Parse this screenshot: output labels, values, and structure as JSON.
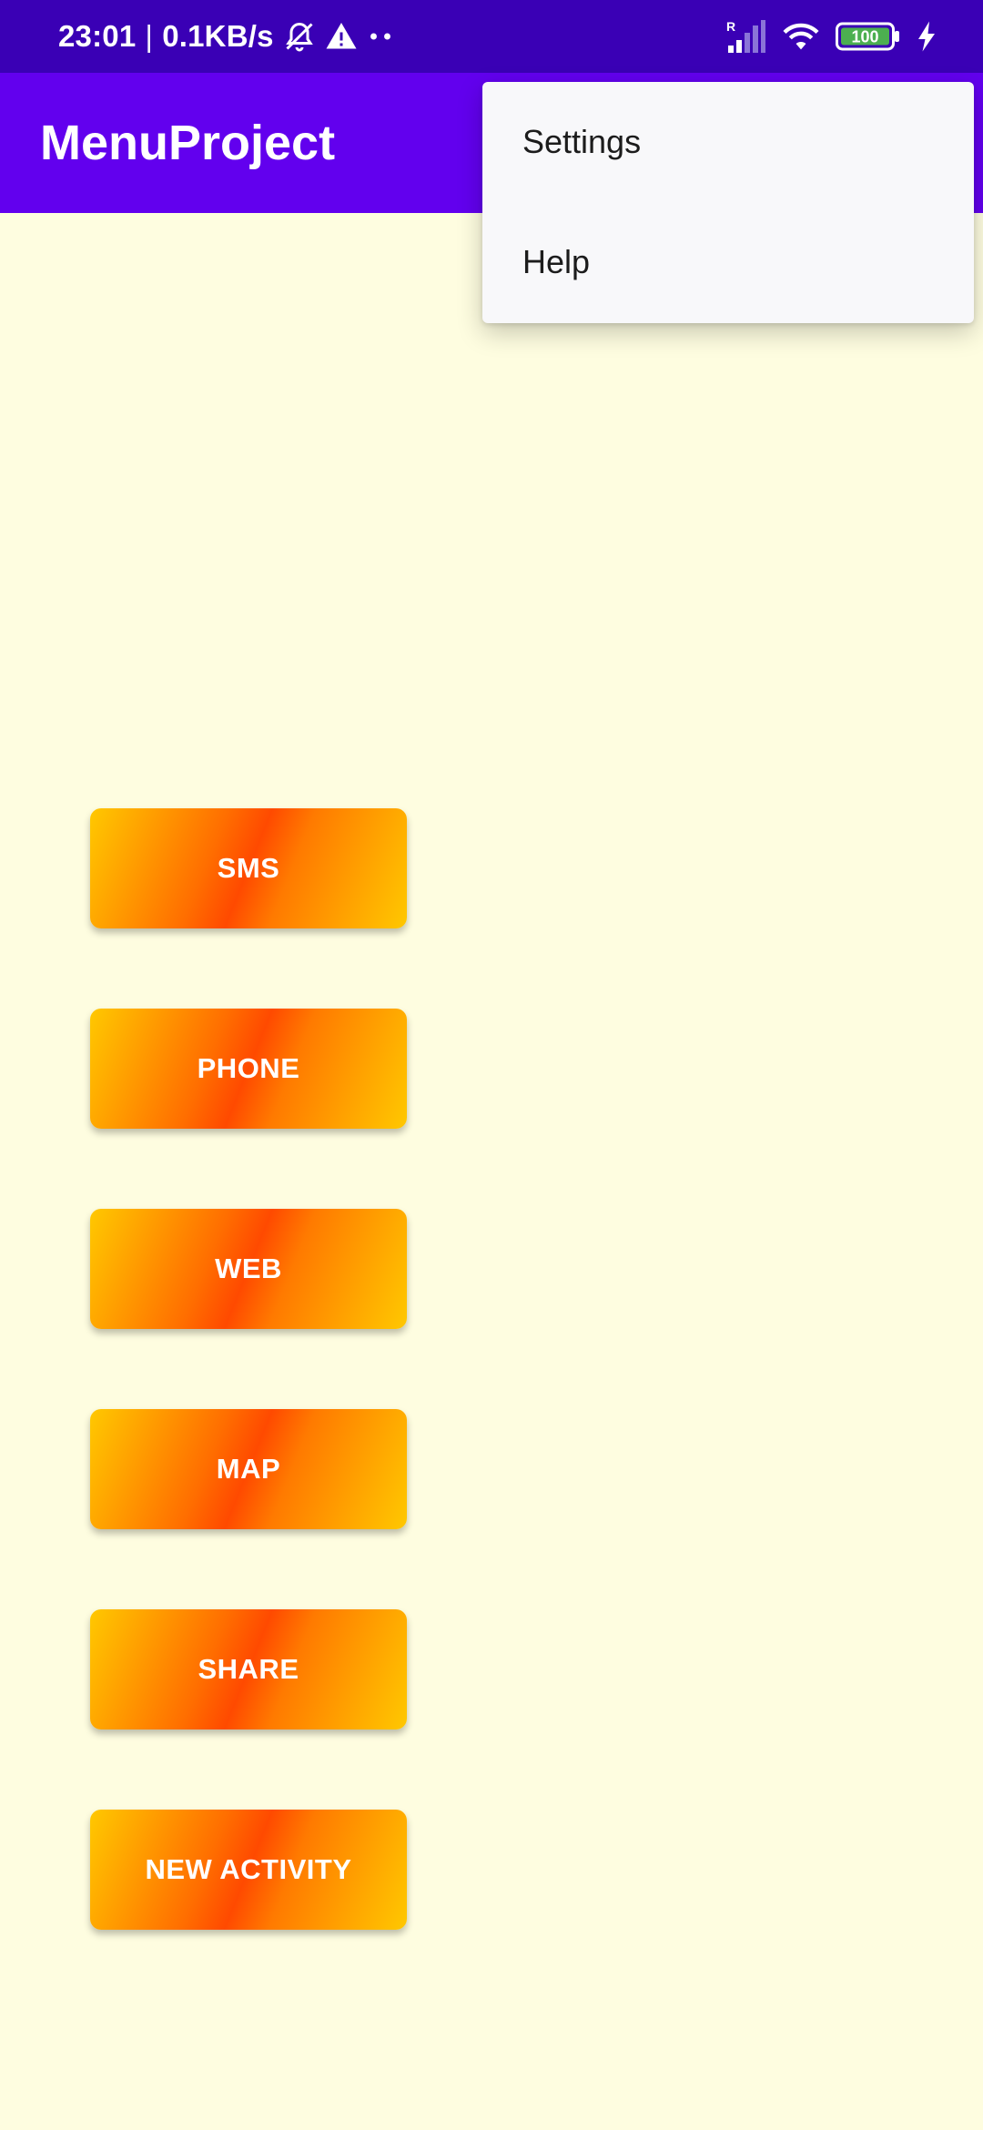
{
  "status_bar": {
    "time": "23:01",
    "separator": "|",
    "speed": "0.1KB/s",
    "battery_level": "100",
    "icons": [
      "bell-off-icon",
      "warning-icon",
      "more-dots-icon",
      "signal-icon",
      "wifi-icon",
      "battery-icon",
      "charging-icon"
    ],
    "signal_tag": "R"
  },
  "app_bar": {
    "title": "MenuProject"
  },
  "overflow_menu": {
    "items": [
      {
        "label": "Settings"
      },
      {
        "label": "Help"
      }
    ]
  },
  "buttons": [
    {
      "label": "SMS"
    },
    {
      "label": "PHONE"
    },
    {
      "label": "WEB"
    },
    {
      "label": "MAP"
    },
    {
      "label": "SHARE"
    },
    {
      "label": "NEW ACTIVITY"
    }
  ],
  "colors": {
    "status_bar": "#3A00B5",
    "app_bar": "#6200EE",
    "background": "#FEFDE0",
    "button_gradient_edge": "#FFC800",
    "button_gradient_center": "#FF4A00",
    "menu_background": "#F8F8FA"
  }
}
